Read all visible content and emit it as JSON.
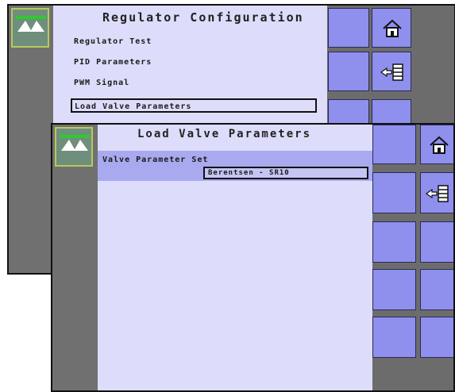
{
  "back_screen": {
    "title": "Regulator Configuration",
    "menu": [
      {
        "label": "Regulator Test"
      },
      {
        "label": "PID Parameters"
      },
      {
        "label": "PWM Signal"
      },
      {
        "label": "Load Valve Parameters"
      }
    ],
    "selected_index": 3
  },
  "front_screen": {
    "title": "Load Valve Parameters",
    "field_label": "Valve Parameter Set",
    "field_value": "Berentsen - SR10"
  },
  "icons": {
    "logo": "sprayer-boom-icon",
    "home": "home-icon",
    "back": "back-arrow-list-icon"
  },
  "colors": {
    "content_bg": "#ddddfb",
    "selected_row": "#a9a9ef",
    "button": "#8f8fee",
    "side_strip": "#707070",
    "logo_bg": "#6f8f7c"
  }
}
